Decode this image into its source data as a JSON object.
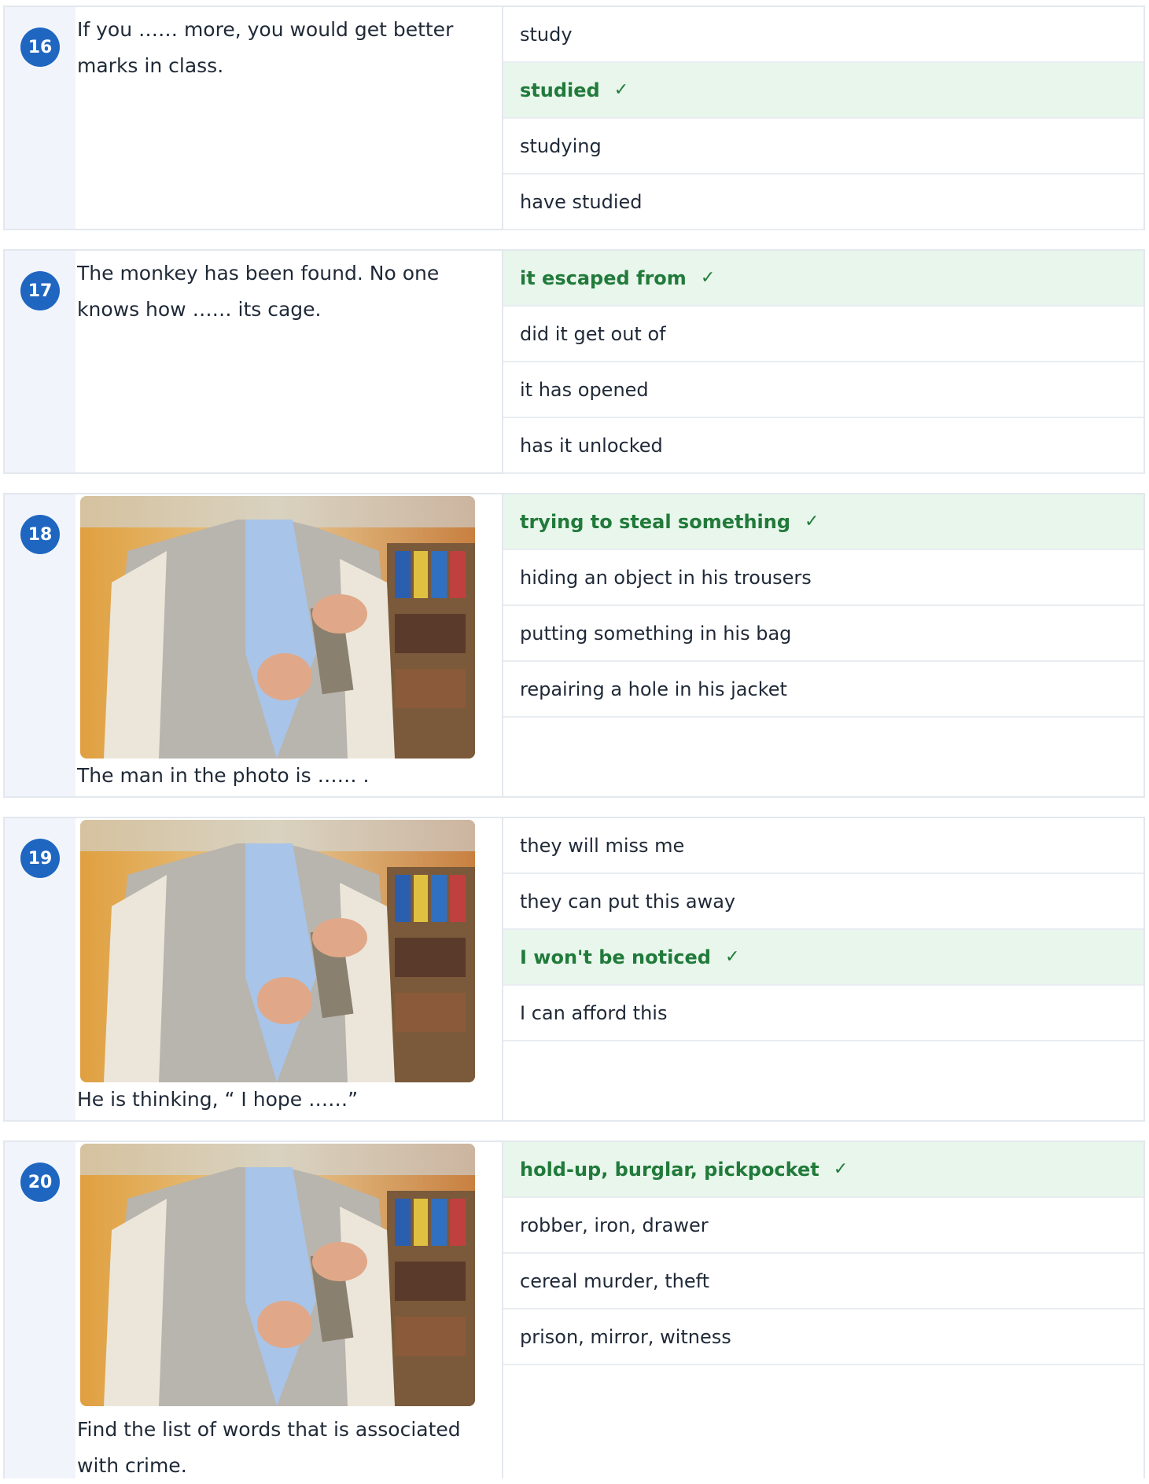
{
  "questions": [
    {
      "number": "16",
      "text": "If you …… more, you would get better marks in class.",
      "options": [
        {
          "label": "study",
          "correct": false
        },
        {
          "label": "studied",
          "correct": true
        },
        {
          "label": "studying",
          "correct": false
        },
        {
          "label": "have studied",
          "correct": false
        }
      ]
    },
    {
      "number": "17",
      "text": "The monkey has been found. No one knows how …… its cage.",
      "options": [
        {
          "label": "it escaped from",
          "correct": true
        },
        {
          "label": "did it get out of",
          "correct": false
        },
        {
          "label": "it has opened",
          "correct": false
        },
        {
          "label": "has it unlocked",
          "correct": false
        }
      ]
    },
    {
      "number": "18",
      "text": "The man in the photo is …… .",
      "options": [
        {
          "label": "trying to steal something",
          "correct": true
        },
        {
          "label": "hiding an object in his trousers",
          "correct": false
        },
        {
          "label": "putting something in his bag",
          "correct": false
        },
        {
          "label": "repairing a hole in his jacket",
          "correct": false
        }
      ]
    },
    {
      "number": "19",
      "text": "He is thinking, “ I hope ……”",
      "options": [
        {
          "label": "they will miss me",
          "correct": false
        },
        {
          "label": "they can put this away",
          "correct": false
        },
        {
          "label": "I won't be noticed",
          "correct": true
        },
        {
          "label": "I can afford this",
          "correct": false
        }
      ]
    },
    {
      "number": "20",
      "text": "Find the list of words that is associated with crime.",
      "options": [
        {
          "label": "hold-up, burglar, pickpocket",
          "correct": true
        },
        {
          "label": "robber, iron, drawer",
          "correct": false
        },
        {
          "label": "cereal murder, theft",
          "correct": false
        },
        {
          "label": "prison, mirror, witness",
          "correct": false
        }
      ]
    }
  ],
  "check_mark": "✓",
  "colors": {
    "badge": "#1f66c1",
    "correct_bg": "#e8f6ec",
    "correct_text": "#217a3a",
    "left_strip": "#f1f5fb",
    "border": "#e3e8ee"
  },
  "icons": {
    "correct": "check-icon"
  }
}
